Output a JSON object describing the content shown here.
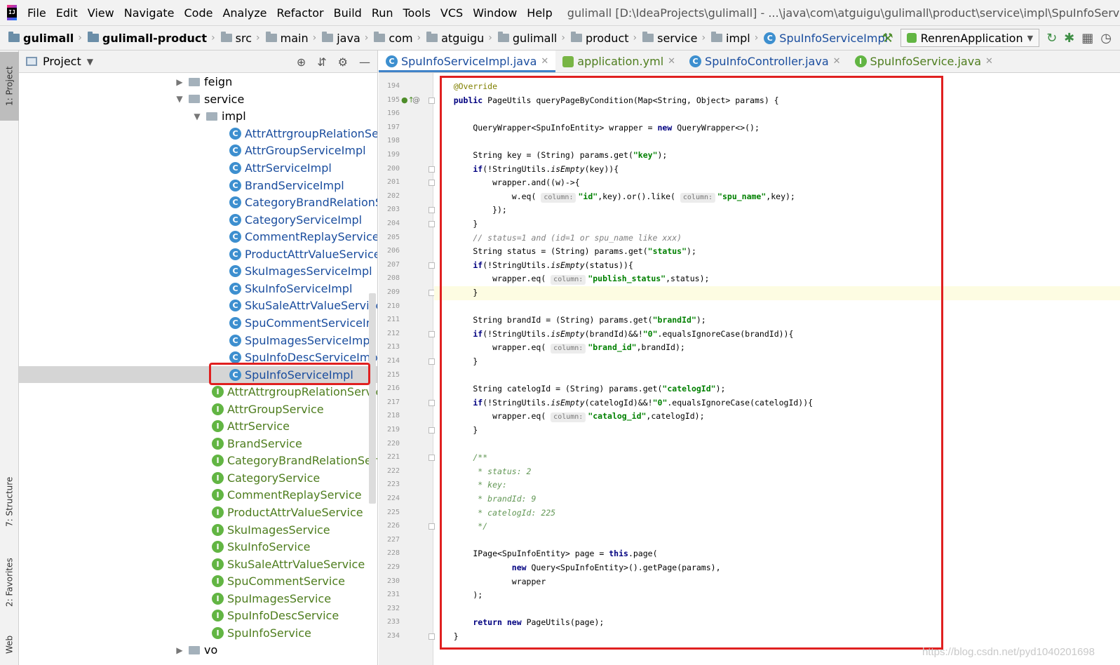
{
  "menubar": {
    "items": [
      "File",
      "Edit",
      "View",
      "Navigate",
      "Code",
      "Analyze",
      "Refactor",
      "Build",
      "Run",
      "Tools",
      "VCS",
      "Window",
      "Help"
    ],
    "window_title": "gulimall [D:\\IdeaProjects\\gulimall] - ...\\java\\com\\atguigu\\gulimall\\product\\service\\impl\\SpuInfoServiceImpl.java"
  },
  "navbar": {
    "crumbs": [
      "gulimall",
      "gulimall-product",
      "src",
      "main",
      "java",
      "com",
      "atguigu",
      "gulimall",
      "product",
      "service",
      "impl"
    ],
    "last": "SpuInfoServiceImpl",
    "run_config": "RenrenApplication"
  },
  "stripe": {
    "project": "1: Project",
    "structure": "7: Structure",
    "favorites": "2: Favorites",
    "web": "Web"
  },
  "project": {
    "title": "Project",
    "tree": [
      {
        "label": "feign",
        "kind": "folder",
        "indent": 222,
        "arrow": "▶"
      },
      {
        "label": "service",
        "kind": "folder",
        "indent": 222,
        "arrow": "▼"
      },
      {
        "label": "impl",
        "kind": "folder",
        "indent": 247,
        "arrow": "▼"
      },
      {
        "label": "AttrAttrgroupRelationServiceImpl",
        "kind": "class",
        "indent": 300
      },
      {
        "label": "AttrGroupServiceImpl",
        "kind": "class",
        "indent": 300
      },
      {
        "label": "AttrServiceImpl",
        "kind": "class",
        "indent": 300
      },
      {
        "label": "BrandServiceImpl",
        "kind": "class",
        "indent": 300
      },
      {
        "label": "CategoryBrandRelationServiceImpl",
        "kind": "class",
        "indent": 300
      },
      {
        "label": "CategoryServiceImpl",
        "kind": "class",
        "indent": 300
      },
      {
        "label": "CommentReplayServiceImpl",
        "kind": "class",
        "indent": 300
      },
      {
        "label": "ProductAttrValueServiceImpl",
        "kind": "class",
        "indent": 300
      },
      {
        "label": "SkuImagesServiceImpl",
        "kind": "class",
        "indent": 300
      },
      {
        "label": "SkuInfoServiceImpl",
        "kind": "class",
        "indent": 300
      },
      {
        "label": "SkuSaleAttrValueServiceImpl",
        "kind": "class",
        "indent": 300
      },
      {
        "label": "SpuCommentServiceImpl",
        "kind": "class",
        "indent": 300
      },
      {
        "label": "SpuImagesServiceImpl",
        "kind": "class",
        "indent": 300
      },
      {
        "label": "SpuInfoDescServiceImpl",
        "kind": "class",
        "indent": 300
      },
      {
        "label": "SpuInfoServiceImpl",
        "kind": "class",
        "indent": 300,
        "selected": true
      },
      {
        "label": "AttrAttrgroupRelationService",
        "kind": "iface",
        "indent": 275
      },
      {
        "label": "AttrGroupService",
        "kind": "iface",
        "indent": 275
      },
      {
        "label": "AttrService",
        "kind": "iface",
        "indent": 275
      },
      {
        "label": "BrandService",
        "kind": "iface",
        "indent": 275
      },
      {
        "label": "CategoryBrandRelationService",
        "kind": "iface",
        "indent": 275
      },
      {
        "label": "CategoryService",
        "kind": "iface",
        "indent": 275
      },
      {
        "label": "CommentReplayService",
        "kind": "iface",
        "indent": 275
      },
      {
        "label": "ProductAttrValueService",
        "kind": "iface",
        "indent": 275
      },
      {
        "label": "SkuImagesService",
        "kind": "iface",
        "indent": 275
      },
      {
        "label": "SkuInfoService",
        "kind": "iface",
        "indent": 275
      },
      {
        "label": "SkuSaleAttrValueService",
        "kind": "iface",
        "indent": 275
      },
      {
        "label": "SpuCommentService",
        "kind": "iface",
        "indent": 275
      },
      {
        "label": "SpuImagesService",
        "kind": "iface",
        "indent": 275
      },
      {
        "label": "SpuInfoDescService",
        "kind": "iface",
        "indent": 275
      },
      {
        "label": "SpuInfoService",
        "kind": "iface",
        "indent": 275
      },
      {
        "label": "vo",
        "kind": "folder",
        "indent": 222,
        "arrow": "▶"
      }
    ]
  },
  "tabs": [
    {
      "label": "SpuInfoServiceImpl.java",
      "kind": "class",
      "active": true
    },
    {
      "label": "application.yml",
      "kind": "yml"
    },
    {
      "label": "SpuInfoController.java",
      "kind": "class"
    },
    {
      "label": "SpuInfoService.java",
      "kind": "iface"
    }
  ],
  "editor": {
    "first_line": 194,
    "lines": [
      [
        [
          "ann",
          "    @Override"
        ]
      ],
      [
        [
          "kw",
          "    public "
        ],
        [
          "",
          "PageUtils queryPageByCondition(Map<String, Object> params) {"
        ]
      ],
      [],
      [
        [
          "",
          "        QueryWrapper<SpuInfoEntity> wrapper = "
        ],
        [
          "kw",
          "new "
        ],
        [
          "",
          "QueryWrapper<>();"
        ]
      ],
      [],
      [
        [
          "",
          "        String key = (String) params.get("
        ],
        [
          "str",
          "\"key\""
        ],
        [
          "",
          ");"
        ]
      ],
      [
        [
          "kw",
          "        if"
        ],
        [
          "",
          "(!StringUtils."
        ],
        [
          "ital",
          "isEmpty"
        ],
        [
          "",
          "(key)){"
        ]
      ],
      [
        [
          "",
          "            wrapper.and((w)->{"
        ]
      ],
      [
        [
          "",
          "                w.eq( "
        ],
        [
          "hint",
          "column:"
        ],
        [
          "str",
          "\"id\""
        ],
        [
          "",
          ",key).or().like( "
        ],
        [
          "hint",
          "column:"
        ],
        [
          "str",
          "\"spu_name\""
        ],
        [
          "",
          ",key);"
        ]
      ],
      [
        [
          "",
          "            });"
        ]
      ],
      [
        [
          "",
          "        }"
        ]
      ],
      [
        [
          "cmt",
          "        // status=1 and (id=1 or spu_name like xxx)"
        ]
      ],
      [
        [
          "",
          "        String status = (String) params.get("
        ],
        [
          "str",
          "\"status\""
        ],
        [
          "",
          ");"
        ]
      ],
      [
        [
          "kw",
          "        if"
        ],
        [
          "",
          "(!StringUtils."
        ],
        [
          "ital",
          "isEmpty"
        ],
        [
          "",
          "(status)){"
        ]
      ],
      [
        [
          "",
          "            wrapper.eq( "
        ],
        [
          "hint",
          "column:"
        ],
        [
          "str",
          "\"publish_status\""
        ],
        [
          "",
          ",status);"
        ]
      ],
      [
        [
          "",
          "        }"
        ]
      ],
      [],
      [
        [
          "",
          "        String brandId = (String) params.get("
        ],
        [
          "str",
          "\"brandId\""
        ],
        [
          "",
          ");"
        ]
      ],
      [
        [
          "kw",
          "        if"
        ],
        [
          "",
          "(!StringUtils."
        ],
        [
          "ital",
          "isEmpty"
        ],
        [
          "",
          "(brandId)&&!"
        ],
        [
          "str",
          "\"0\""
        ],
        [
          "",
          ".equalsIgnoreCase(brandId)){"
        ]
      ],
      [
        [
          "",
          "            wrapper.eq( "
        ],
        [
          "hint",
          "column:"
        ],
        [
          "str",
          "\"brand_id\""
        ],
        [
          "",
          ",brandId);"
        ]
      ],
      [
        [
          "",
          "        }"
        ]
      ],
      [],
      [
        [
          "",
          "        String catelogId = (String) params.get("
        ],
        [
          "str",
          "\"catelogId\""
        ],
        [
          "",
          ");"
        ]
      ],
      [
        [
          "kw",
          "        if"
        ],
        [
          "",
          "(!StringUtils."
        ],
        [
          "ital",
          "isEmpty"
        ],
        [
          "",
          "(catelogId)&&!"
        ],
        [
          "str",
          "\"0\""
        ],
        [
          "",
          ".equalsIgnoreCase(catelogId)){"
        ]
      ],
      [
        [
          "",
          "            wrapper.eq( "
        ],
        [
          "hint",
          "column:"
        ],
        [
          "str",
          "\"catalog_id\""
        ],
        [
          "",
          ",catelogId);"
        ]
      ],
      [
        [
          "",
          "        }"
        ]
      ],
      [],
      [
        [
          "doc",
          "        /**"
        ]
      ],
      [
        [
          "doc",
          "         * status: 2"
        ]
      ],
      [
        [
          "doc",
          "         * key:"
        ]
      ],
      [
        [
          "doc",
          "         * brandId: 9"
        ]
      ],
      [
        [
          "doc",
          "         * catelogId: 225"
        ]
      ],
      [
        [
          "doc",
          "         */"
        ]
      ],
      [],
      [
        [
          "",
          "        IPage<SpuInfoEntity> page = "
        ],
        [
          "kw",
          "this"
        ],
        [
          "",
          ".page("
        ]
      ],
      [
        [
          "kw",
          "                new "
        ],
        [
          "",
          "Query<SpuInfoEntity>().getPage(params),"
        ]
      ],
      [
        [
          "",
          "                wrapper"
        ]
      ],
      [
        [
          "",
          "        );"
        ]
      ],
      [],
      [
        [
          "kw",
          "        return new "
        ],
        [
          "",
          "PageUtils(page);"
        ]
      ],
      [
        [
          "",
          "    }"
        ]
      ]
    ],
    "current_line": 209
  },
  "watermark": "https://blog.csdn.net/pyd1040201698"
}
